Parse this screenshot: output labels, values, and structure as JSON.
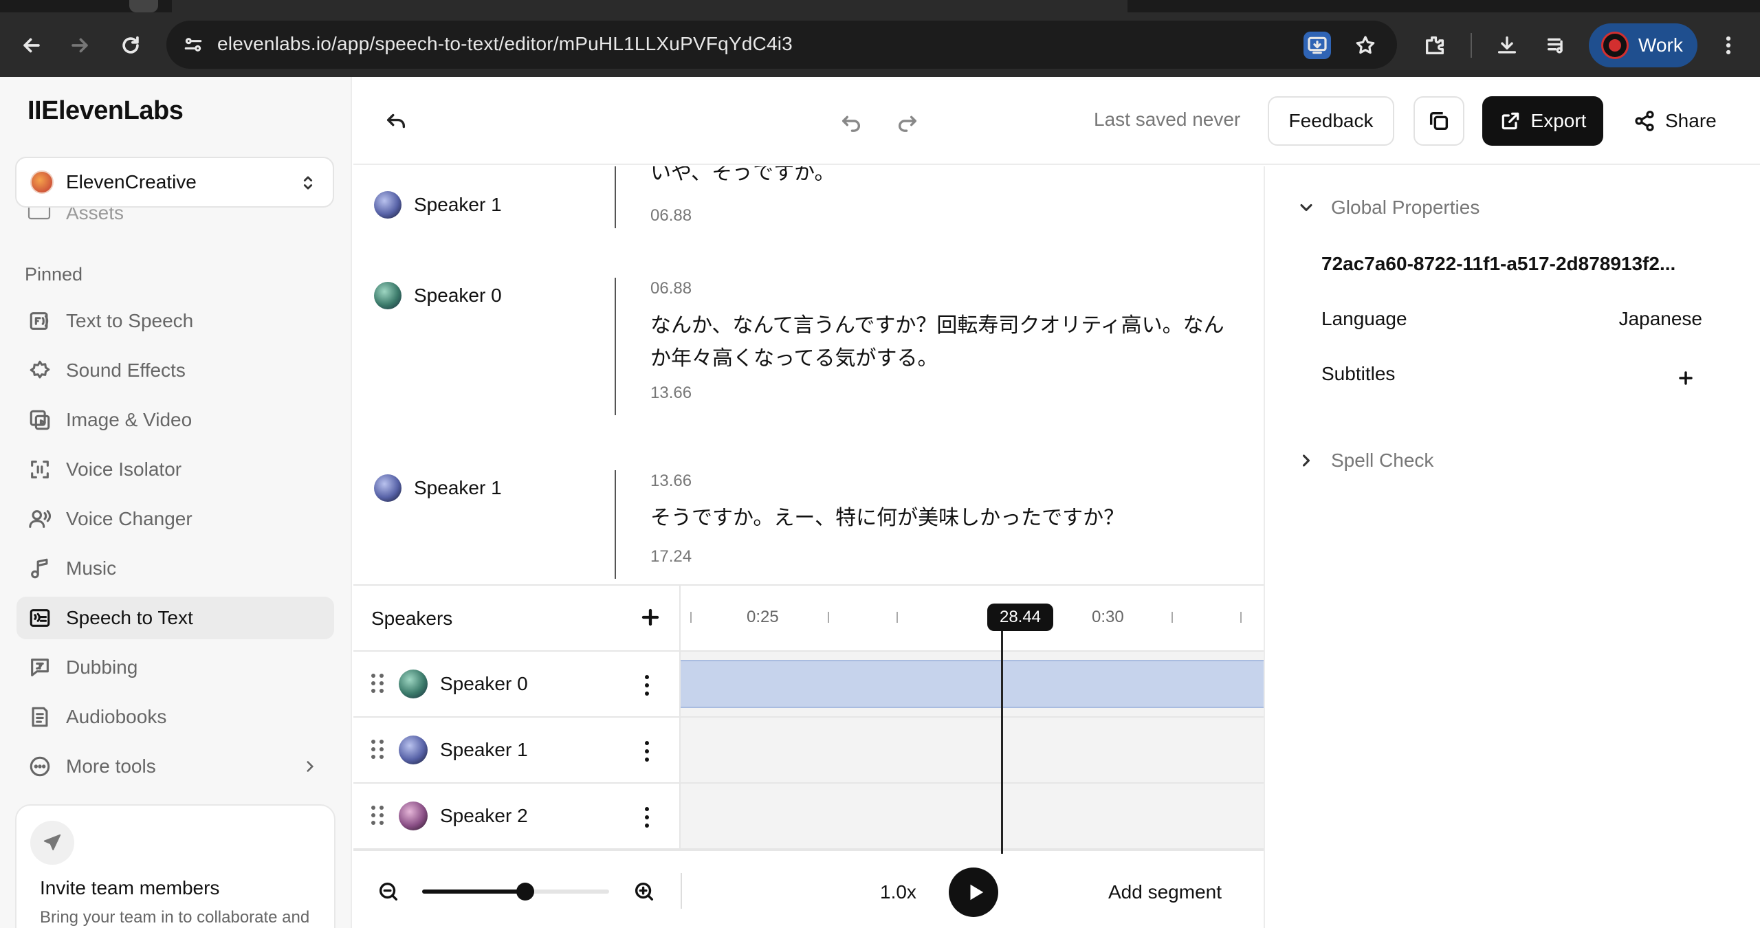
{
  "browser": {
    "url": "elevenlabs.io/app/speech-to-text/editor/mPuHL1LLXuPVFqYdC4i3",
    "profile_label": "Work"
  },
  "sidebar": {
    "logo": "IIElevenLabs",
    "workspace": "ElevenCreative",
    "partial_item": "Assets",
    "pinned_label": "Pinned",
    "items": [
      {
        "label": "Text to Speech",
        "icon": "text-to-speech-icon"
      },
      {
        "label": "Sound Effects",
        "icon": "sound-effects-icon"
      },
      {
        "label": "Image & Video",
        "icon": "image-video-icon"
      },
      {
        "label": "Voice Isolator",
        "icon": "voice-isolator-icon"
      },
      {
        "label": "Voice Changer",
        "icon": "voice-changer-icon"
      },
      {
        "label": "Music",
        "icon": "music-icon"
      },
      {
        "label": "Speech to Text",
        "icon": "speech-to-text-icon",
        "active": true
      },
      {
        "label": "Dubbing",
        "icon": "dubbing-icon"
      },
      {
        "label": "Audiobooks",
        "icon": "audiobooks-icon"
      },
      {
        "label": "More tools",
        "icon": "more-tools-icon"
      }
    ],
    "invite": {
      "title": "Invite team members",
      "subtitle": "Bring your team in to collaborate and share generations"
    }
  },
  "header": {
    "last_saved": "Last saved never",
    "feedback": "Feedback",
    "export": "Export",
    "share": "Share"
  },
  "transcript": [
    {
      "speaker": "Speaker 1",
      "avatar": "av1",
      "start": "",
      "text": "いや、そうですか。",
      "end": "06.88"
    },
    {
      "speaker": "Speaker 0",
      "avatar": "av0",
      "start": "06.88",
      "text": "なんか、なんて言うんですか？回転寿司クオリティ高い。なんか年々高くなってる気がする。",
      "end": "13.66"
    },
    {
      "speaker": "Speaker 1",
      "avatar": "av1",
      "start": "13.66",
      "text": "そうですか。えー、特に何が美味しかったですか？",
      "end": "17.24"
    }
  ],
  "timeline": {
    "speakers_title": "Speakers",
    "ruler_labels": [
      "0:25",
      "0:30"
    ],
    "playhead": "28.44",
    "playhead_fraction": 0.55,
    "speakers": [
      {
        "name": "Speaker 0",
        "avatar": "av0"
      },
      {
        "name": "Speaker 1",
        "avatar": "av1"
      },
      {
        "name": "Speaker 2",
        "avatar": "av2"
      }
    ],
    "zoom_level": 0.55,
    "speed": "1.0x",
    "add_segment": "Add segment"
  },
  "properties": {
    "global_title": "Global Properties",
    "file_id": "72ac7a60-8722-11f1-a517-2d878913f2...",
    "language_label": "Language",
    "language_value": "Japanese",
    "subtitles_label": "Subtitles",
    "spell_check_title": "Spell Check"
  }
}
